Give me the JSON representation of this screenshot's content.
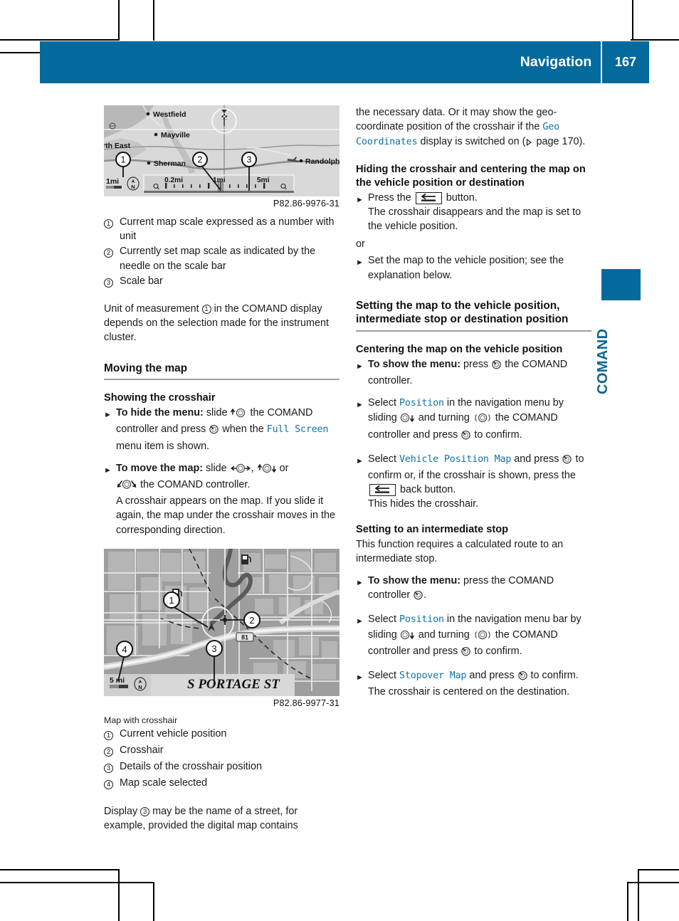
{
  "header": {
    "title": "Navigation",
    "page_number": "167"
  },
  "side_tab": {
    "label": "COMAND"
  },
  "left_column": {
    "figure1": {
      "image_code": "P82.86-9976-31",
      "map_labels": {
        "westfield": "Westfield",
        "mayville": "Mayville",
        "north_east": "rth East",
        "sherman": "Sherman",
        "randolph": "Randolph",
        "scale_value": "1mi",
        "scale_min": "0.2mi",
        "scale_mid": "1mi",
        "scale_max": "5mi",
        "compass": "N"
      },
      "callouts": [
        "1",
        "2",
        "3"
      ]
    },
    "legend1": [
      {
        "num": "1",
        "text": "Current map scale expressed as a number with unit"
      },
      {
        "num": "2",
        "text": "Currently set map scale as indicated by the needle on the scale bar"
      },
      {
        "num": "3",
        "text": "Scale bar"
      }
    ],
    "paragraph1_part1": "Unit of measurement ",
    "paragraph1_num": "1",
    "paragraph1_part2": " in the COMAND display depends on the selection made for the instrument cluster.",
    "heading_moving_map": "Moving the map",
    "heading_showing_crosshair": "Showing the crosshair",
    "step_hide_menu": {
      "bold": "To hide the menu:",
      "text_a": " slide ",
      "text_b": " the COMAND controller and press ",
      "text_c": " when the ",
      "menu_item": "Full Screen",
      "text_d": " menu item is shown."
    },
    "step_move_map": {
      "bold": "To move the map:",
      "text_a": " slide ",
      "text_b": ", ",
      "text_c": " or ",
      "text_d": " the COMAND controller.",
      "sub_text": "A crosshair appears on the map. If you slide it again, the map under the crosshair moves in the corresponding direction."
    },
    "figure2": {
      "image_code": "P82.86-9977-31",
      "map_labels": {
        "street_name": "S PORTAGE ST",
        "scale_value": "5 mi",
        "highway_shield": "81",
        "compass": "N"
      },
      "callouts": [
        "1",
        "2",
        "3",
        "4"
      ]
    },
    "figure2_caption": "Map with crosshair",
    "legend2": [
      {
        "num": "1",
        "text": "Current vehicle position"
      },
      {
        "num": "2",
        "text": "Crosshair"
      },
      {
        "num": "3",
        "text": "Details of the crosshair position"
      },
      {
        "num": "4",
        "text": "Map scale selected"
      }
    ],
    "paragraph2_part1": "Display ",
    "paragraph2_num": "3",
    "paragraph2_part2": " may be the name of a street, for example, provided the digital map contains"
  },
  "right_column": {
    "paragraph_top_a": "the necessary data. Or it may show the geo-coordinate position of the crosshair if the ",
    "paragraph_top_menu": "Geo Coordinates",
    "paragraph_top_b": " display is switched on (",
    "paragraph_top_ref": " page 170).",
    "heading_hiding": "Hiding the crosshair and centering the map on the vehicle position or destination",
    "step_press_back": {
      "text_a": "Press the ",
      "text_b": " button.",
      "sub_text": "The crosshair disappears and the map is set to the vehicle position."
    },
    "or_text": "or",
    "step_set_map": "Set the map to the vehicle position; see the explanation below.",
    "heading_setting": "Setting the map to the vehicle position, intermediate stop or destination position",
    "heading_centering": "Centering the map on the vehicle position",
    "step_show_menu_1": {
      "bold": "To show the menu:",
      "text_a": " press ",
      "text_b": " the COMAND controller."
    },
    "step_select_position_1": {
      "text_a": "Select ",
      "menu_item": "Position",
      "text_b": " in the navigation menu by sliding ",
      "text_c": " and turning ",
      "text_d": " the COMAND controller and press ",
      "text_e": " to confirm."
    },
    "step_select_vehicle_map": {
      "text_a": "Select ",
      "menu_item": "Vehicle Position Map",
      "text_b": " and press ",
      "text_c": " to confirm or, if the crosshair is shown, press the ",
      "text_d": " back button.",
      "sub_text": "This hides the crosshair."
    },
    "heading_intermediate": "Setting to an intermediate stop",
    "paragraph_intermediate": "This function requires a calculated route to an intermediate stop.",
    "step_show_menu_2": {
      "bold": "To show the menu:",
      "text_a": " press the COMAND controller ",
      "text_b": "."
    },
    "step_select_position_2": {
      "text_a": "Select ",
      "menu_item": "Position",
      "text_b": " in the navigation menu bar by sliding ",
      "text_c": " and turning ",
      "text_d": " the COMAND controller and press ",
      "text_e": " to confirm."
    },
    "step_select_stopover": {
      "text_a": "Select ",
      "menu_item": "Stopover Map",
      "text_b": " and press ",
      "text_c": " to confirm.",
      "sub_text": "The crosshair is centered on the destination."
    }
  },
  "colors": {
    "brand_blue": "#046a9c",
    "menu_item_blue": "#1471a8",
    "rule_gray": "#9aa0a4"
  }
}
